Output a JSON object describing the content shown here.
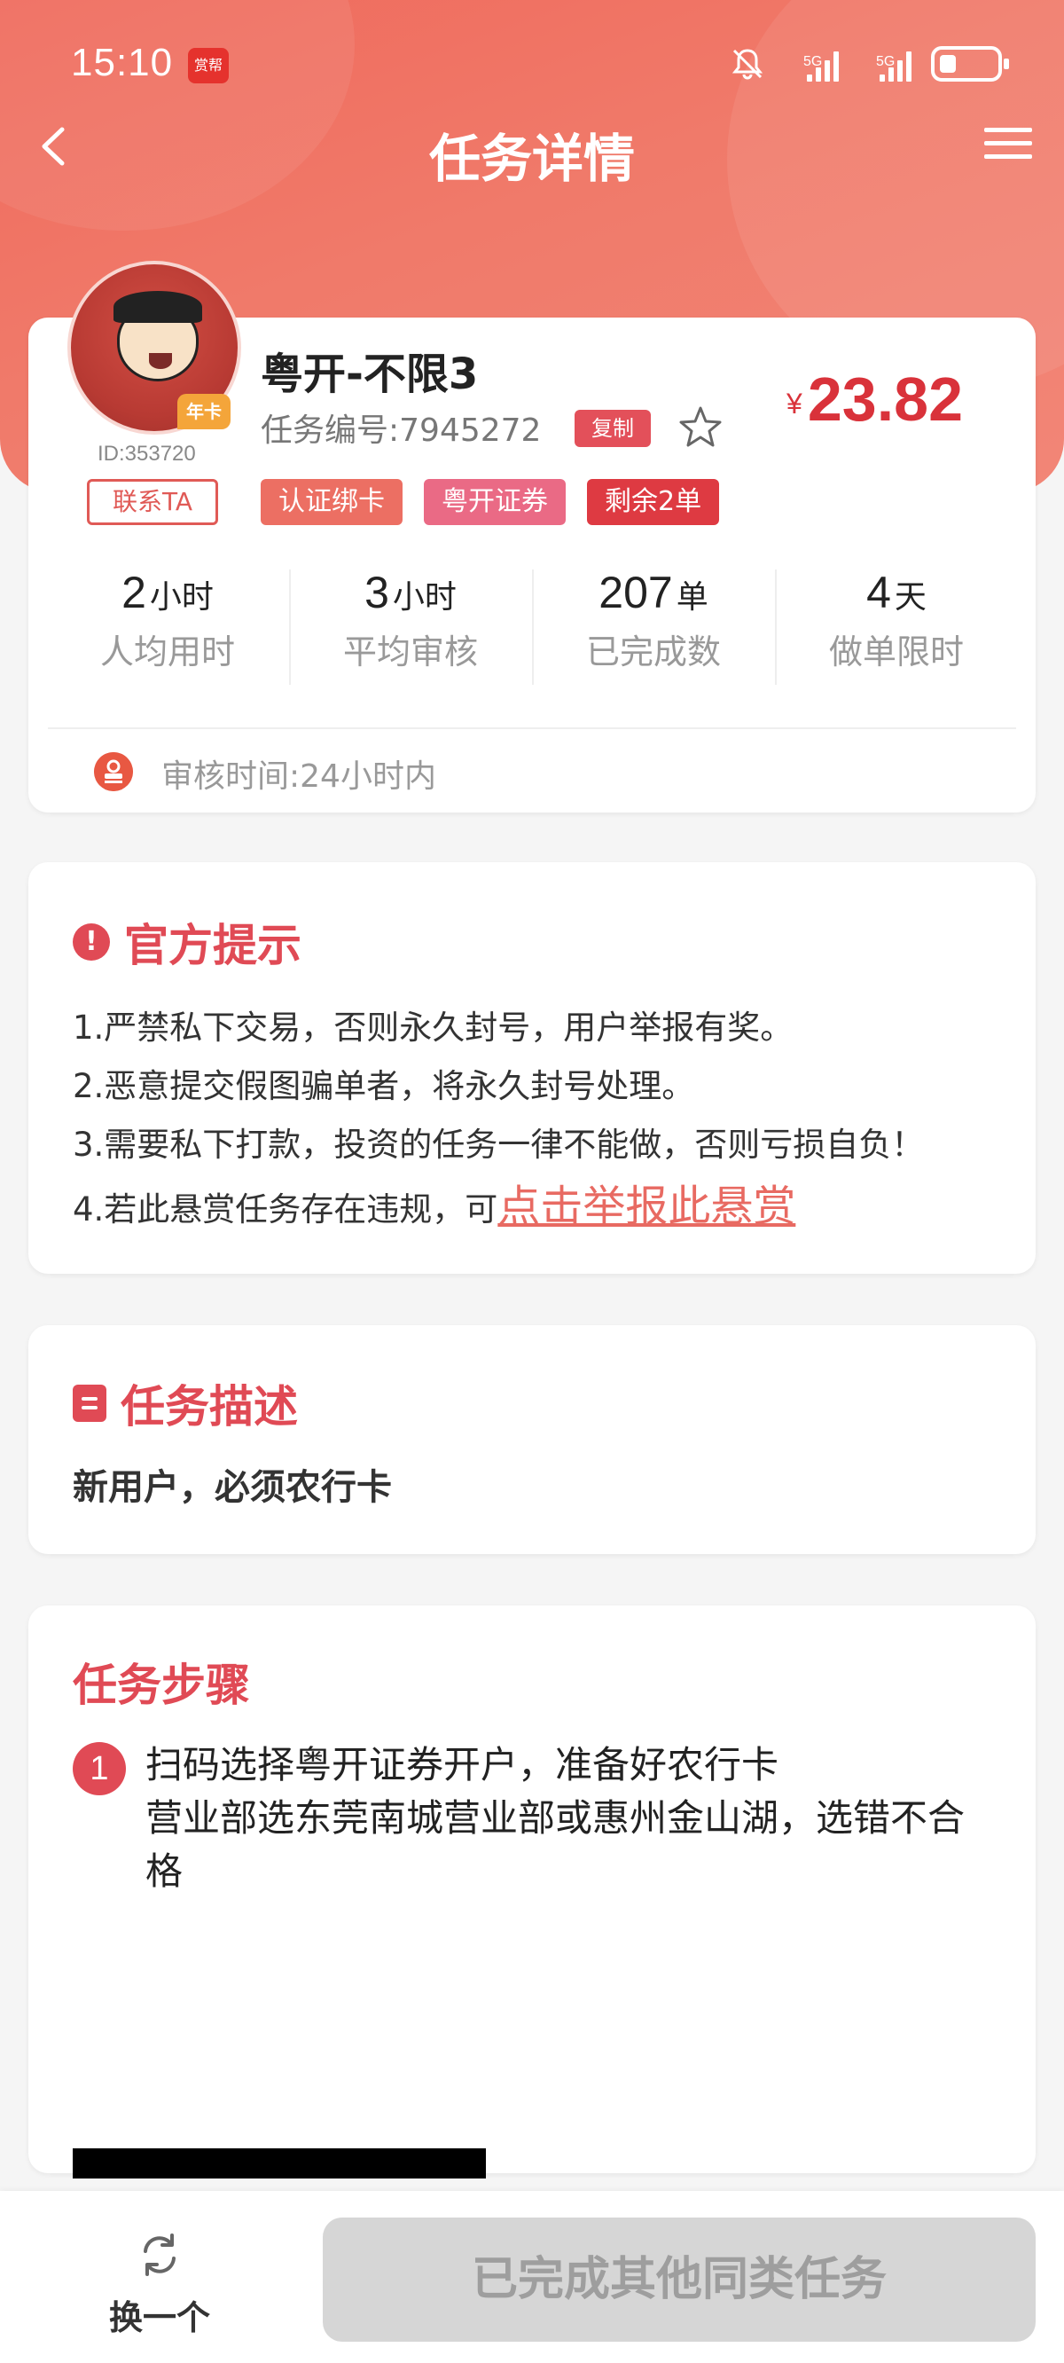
{
  "status_bar": {
    "time": "15:10",
    "app_badge": "赏帮",
    "signal1_label": "5G",
    "signal2_label": "5G"
  },
  "nav": {
    "title": "任务详情"
  },
  "task": {
    "avatar_badge": "年卡",
    "user_id": "ID:353720",
    "title": "粤开-不限3",
    "task_no": "任务编号:7945272",
    "copy_label": "复制",
    "currency": "¥",
    "price": "23.82",
    "contact_label": "联系TA",
    "tags": [
      "认证绑卡",
      "粤开证券",
      "剩余2单"
    ],
    "stats": [
      {
        "num": "2",
        "unit": "小时",
        "label": "人均用时"
      },
      {
        "num": "3",
        "unit": "小时",
        "label": "平均审核"
      },
      {
        "num": "207",
        "unit": "单",
        "label": "已完成数"
      },
      {
        "num": "4",
        "unit": "天",
        "label": "做单限时"
      }
    ],
    "audit_time": "审核时间:24小时内"
  },
  "tips": {
    "title": "官方提示",
    "icon": "!",
    "lines": [
      "1.严禁私下交易，否则永久封号，用户举报有奖。",
      "2.恶意提交假图骗单者，将永久封号处理。",
      "3.需要私下打款，投资的任务一律不能做，否则亏损自负！",
      "4.若此悬赏任务存在违规，可"
    ],
    "report_link": "点击举报此悬赏"
  },
  "description": {
    "title": "任务描述",
    "text": "新用户，必须农行卡"
  },
  "steps": {
    "title": "任务步骤",
    "items": [
      {
        "num": "1",
        "text": "扫码选择粤开证券开户，准备好农行卡\n营业部选东莞南城营业部或惠州金山湖，选错不合格"
      }
    ]
  },
  "bottom": {
    "swap_label": "换一个",
    "done_label": "已完成其他同类任务"
  },
  "colors": {
    "header": "#ef6a5c",
    "price": "#d9323a",
    "accent": "#e04a55",
    "disabled_button": "#d6d6d6"
  },
  "icons": [
    "back-arrow-icon",
    "menu-icon",
    "star-icon",
    "bell-mute-icon",
    "audit-stamp-icon",
    "warning-icon",
    "document-icon",
    "refresh-icon"
  ]
}
